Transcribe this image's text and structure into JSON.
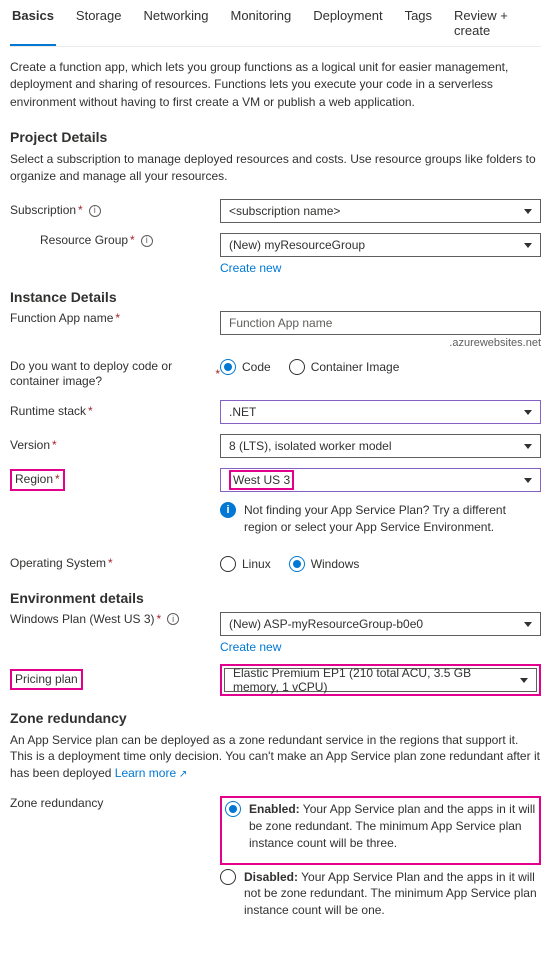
{
  "tabs": [
    "Basics",
    "Storage",
    "Networking",
    "Monitoring",
    "Deployment",
    "Tags",
    "Review + create"
  ],
  "intro": "Create a function app, which lets you group functions as a logical unit for easier management, deployment and sharing of resources. Functions lets you execute your code in a serverless environment without having to first create a VM or publish a web application.",
  "projectDetails": {
    "heading": "Project Details",
    "desc": "Select a subscription to manage deployed resources and costs. Use resource groups like folders to organize and manage all your resources.",
    "subscriptionLabel": "Subscription",
    "subscriptionValue": "<subscription name>",
    "resourceGroupLabel": "Resource Group",
    "resourceGroupValue": "(New) myResourceGroup",
    "createNew": "Create new"
  },
  "instanceDetails": {
    "heading": "Instance Details",
    "nameLabel": "Function App name",
    "namePlaceholder": "Function App name",
    "nameSuffix": ".azurewebsites.net",
    "deployLabel": "Do you want to deploy code or container image?",
    "codeOpt": "Code",
    "containerOpt": "Container Image",
    "runtimeLabel": "Runtime stack",
    "runtimeValue": ".NET",
    "versionLabel": "Version",
    "versionValue": "8 (LTS), isolated worker model",
    "regionLabel": "Region",
    "regionValue": "West US 3",
    "regionHint": "Not finding your App Service Plan? Try a different region or select your App Service Environment.",
    "osLabel": "Operating System",
    "linuxOpt": "Linux",
    "windowsOpt": "Windows"
  },
  "envDetails": {
    "heading": "Environment details",
    "planLabel": "Windows Plan (West US 3)",
    "planValue": "(New) ASP-myResourceGroup-b0e0",
    "createNew": "Create new",
    "pricingLabel": "Pricing plan",
    "pricingValue": "Elastic Premium EP1 (210 total ACU, 3.5 GB memory, 1 vCPU)"
  },
  "zone": {
    "heading": "Zone redundancy",
    "desc": "An App Service plan can be deployed as a zone redundant service in the regions that support it. This is a deployment time only decision. You can't make an App Service plan zone redundant after it has been deployed ",
    "learnMore": "Learn more",
    "label": "Zone redundancy",
    "enabledTitle": "Enabled:",
    "enabledDesc": " Your App Service plan and the apps in it will be zone redundant. The minimum App Service plan instance count will be three.",
    "disabledTitle": "Disabled:",
    "disabledDesc": " Your App Service Plan and the apps in it will not be zone redundant. The minimum App Service plan instance count will be one."
  }
}
